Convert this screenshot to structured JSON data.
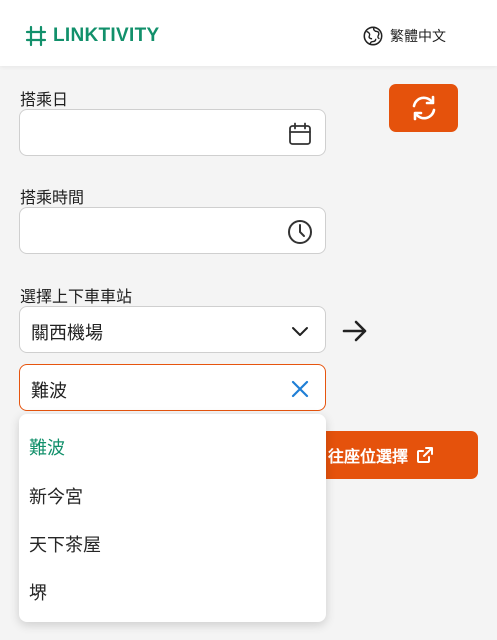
{
  "header": {
    "brand": "LINKTIVITY",
    "language": "繁體中文"
  },
  "form": {
    "date_label": "搭乘日",
    "date_value": "",
    "time_label": "搭乘時間",
    "time_value": "",
    "station_label": "選擇上下車車站",
    "from_station": "關西機場",
    "to_station": "難波"
  },
  "buttons": {
    "seat_select": "往座位選擇"
  },
  "dropdown": {
    "options": [
      "難波",
      "新今宮",
      "天下茶屋",
      "堺"
    ],
    "selected_index": 0
  },
  "colors": {
    "brand_green": "#12906b",
    "accent_orange": "#e5520c",
    "clear_blue": "#1f7fd6"
  }
}
